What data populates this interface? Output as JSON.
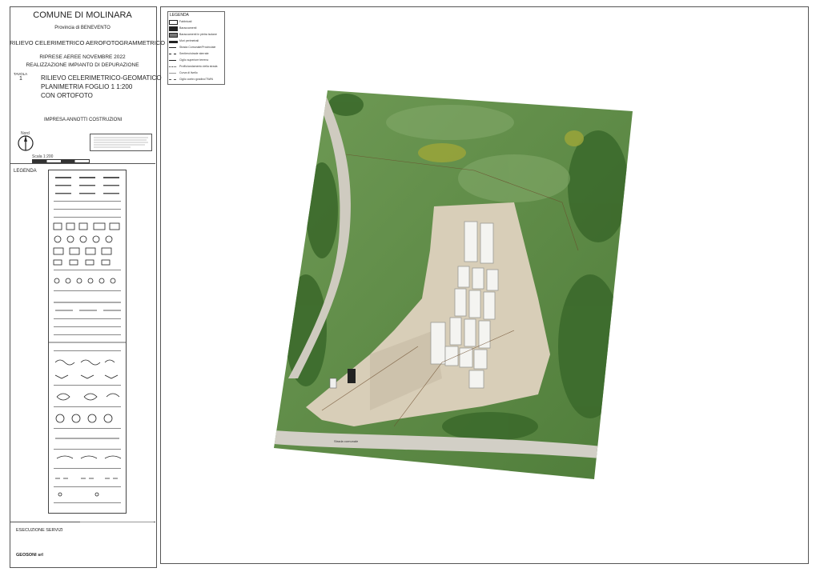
{
  "title_block": {
    "comune": "COMUNE DI MOLINARA",
    "provincia": "Provincia di BENEVENTO",
    "rilievo": "RILIEVO CELERIMETRICO AEROFOTOGRAMMETRICO",
    "riprese": "RIPRESE AEREE NOVEMBRE 2022",
    "realizzazione": "REALIZZAZIONE IMPIANTO DI DEPURAZIONE",
    "tavola_label": "TAVOLA",
    "tavola_num": "1",
    "drawing_title_1": "RILIEVO CELERIMETRICO-GEOMATICO",
    "drawing_title_2": "PLANIMETRIA FOGLIO 1 1:200",
    "drawing_title_3": "CON ORTOFOTO",
    "impresa": "IMPRESA ANNOTTI COSTRUZIONI",
    "north_label": "Nord",
    "scale_label": "Scala 1:200",
    "legenda": "LEGENDA",
    "esecuzione": "ESECUZIONE SERVIZI",
    "geosonic": "GEOSONI srl"
  },
  "map_legend": {
    "title": "LEGENDA",
    "items": [
      "Fabbricati",
      "Baraccamenti",
      "Baraccamenti in pietra isolane",
      "Muri perimetrali",
      "Strada Comunale/Provinciale",
      "Sentiero/strade sterrate",
      "Ciglio superiore terreno",
      "Profilo/andamento della strada",
      "Curva di livello",
      "Ciglio contro gradino/TWIN"
    ]
  },
  "ortho": {
    "road_label": "Strada comunale"
  },
  "colors": {
    "grass": "#5f8a47",
    "dark_veg": "#3d6a2b",
    "earth": "#d6ccb7",
    "tank": "#f2f2f0",
    "frame": "#555555"
  }
}
